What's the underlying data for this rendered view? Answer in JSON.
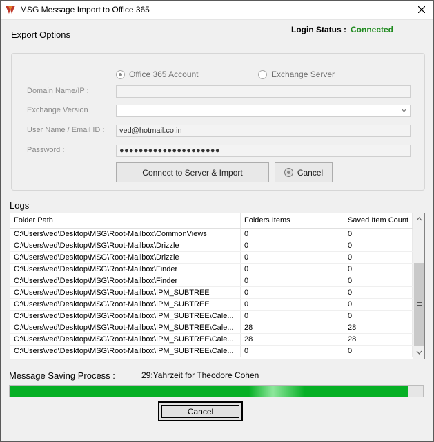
{
  "window": {
    "title": "MSG Message Import to Office 365"
  },
  "export_options": {
    "title": "Export Options",
    "login_status_label": "Login Status :",
    "login_status_value": "Connected",
    "radio_office365": "Office 365 Account",
    "radio_exchange": "Exchange Server",
    "selected": "Office 365 Account",
    "domain_label": "Domain Name/IP :",
    "domain_value": "",
    "exchange_version_label": "Exchange Version",
    "exchange_version_value": "",
    "username_label": "User Name / Email ID :",
    "username_value": "ved@hotmail.co.in",
    "password_label": "Password :",
    "password_value": "●●●●●●●●●●●●●●●●●●●●●",
    "connect_button": "Connect to Server & Import",
    "cancel_button": "Cancel"
  },
  "logs": {
    "title": "Logs",
    "columns": [
      "Folder Path",
      "Folders Items",
      "Saved Item Count"
    ],
    "rows": [
      [
        "C:\\Users\\ved\\Desktop\\MSG\\Root-Mailbox\\CommonViews",
        "0",
        "0"
      ],
      [
        "C:\\Users\\ved\\Desktop\\MSG\\Root-Mailbox\\Drizzle",
        "0",
        "0"
      ],
      [
        "C:\\Users\\ved\\Desktop\\MSG\\Root-Mailbox\\Drizzle",
        "0",
        "0"
      ],
      [
        "C:\\Users\\ved\\Desktop\\MSG\\Root-Mailbox\\Finder",
        "0",
        "0"
      ],
      [
        "C:\\Users\\ved\\Desktop\\MSG\\Root-Mailbox\\Finder",
        "0",
        "0"
      ],
      [
        "C:\\Users\\ved\\Desktop\\MSG\\Root-Mailbox\\IPM_SUBTREE",
        "0",
        "0"
      ],
      [
        "C:\\Users\\ved\\Desktop\\MSG\\Root-Mailbox\\IPM_SUBTREE",
        "0",
        "0"
      ],
      [
        "C:\\Users\\ved\\Desktop\\MSG\\Root-Mailbox\\IPM_SUBTREE\\Cale...",
        "0",
        "0"
      ],
      [
        "C:\\Users\\ved\\Desktop\\MSG\\Root-Mailbox\\IPM_SUBTREE\\Cale...",
        "28",
        "28"
      ],
      [
        "C:\\Users\\ved\\Desktop\\MSG\\Root-Mailbox\\IPM_SUBTREE\\Cale...",
        "28",
        "28"
      ],
      [
        "C:\\Users\\ved\\Desktop\\MSG\\Root-Mailbox\\IPM_SUBTREE\\Cale...",
        "0",
        "0"
      ]
    ]
  },
  "process": {
    "label": "Message Saving Process :",
    "value": "29:Yahrzeit for Theodore Cohen",
    "progress_fraction": 0.965
  },
  "footer": {
    "cancel_button": "Cancel"
  },
  "colors": {
    "connected": "#1e8a1e",
    "progress": "#06b025"
  },
  "icons": {
    "app": "app-logo-icon",
    "close": "close-icon",
    "cancel": "cancel-icon",
    "dropdown": "chevron-down-icon"
  }
}
